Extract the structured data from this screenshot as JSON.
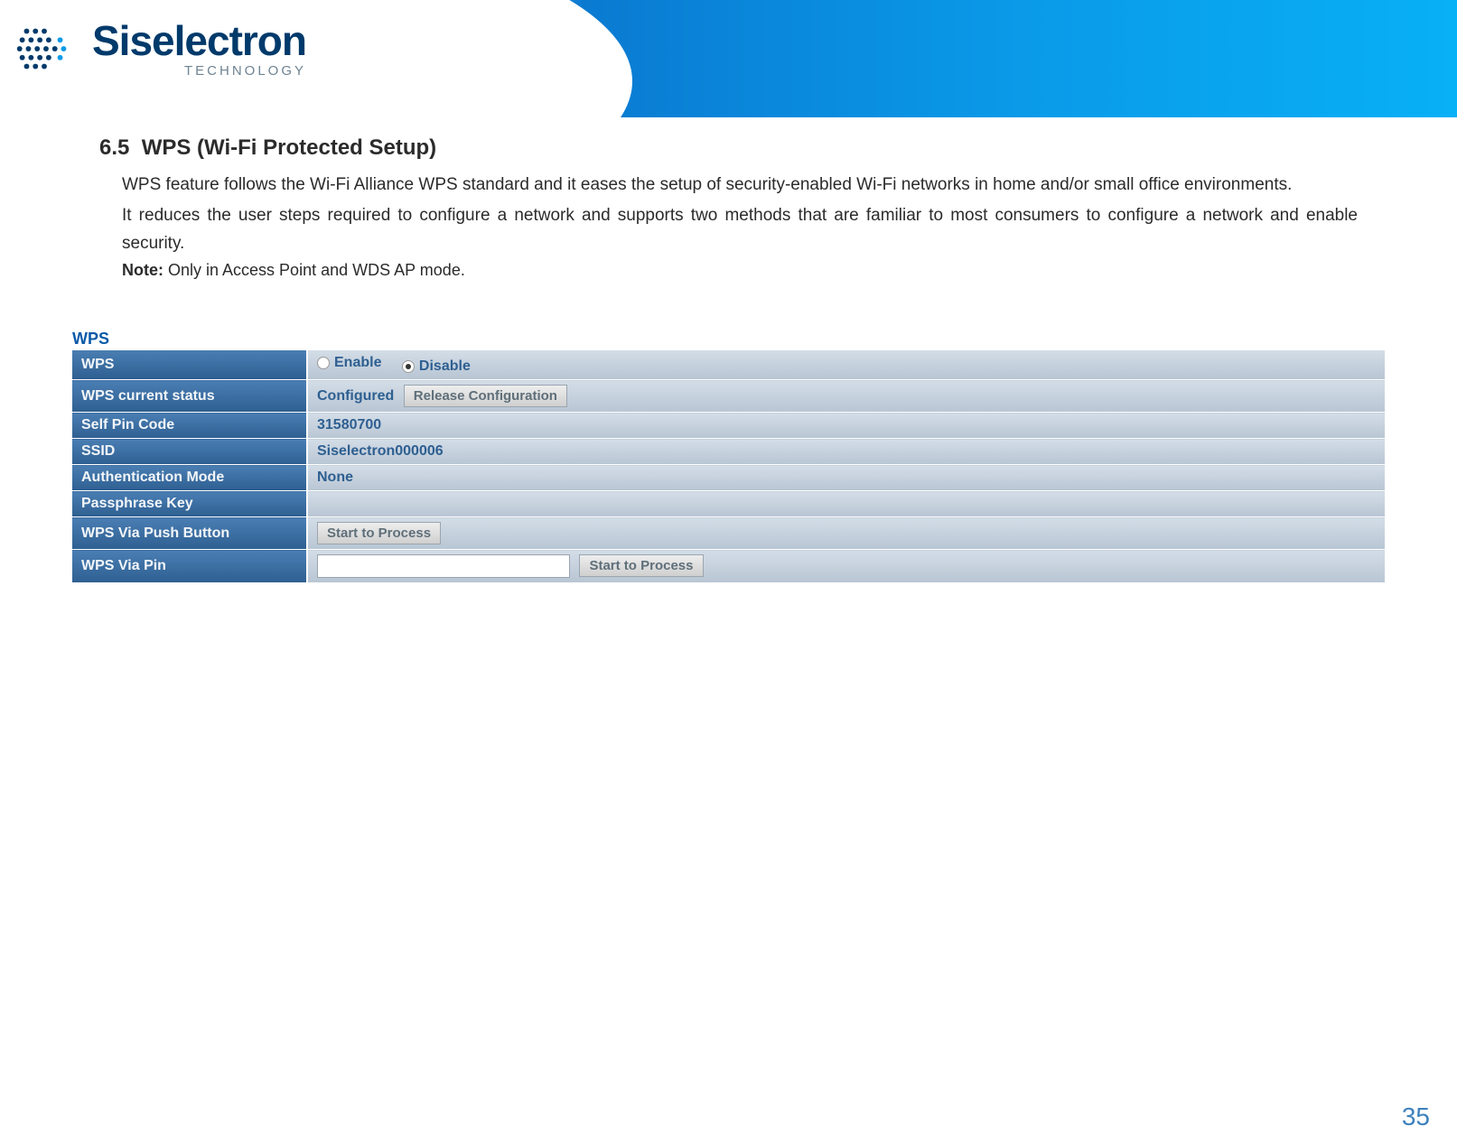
{
  "logo": {
    "brand": "Siselectron",
    "tagline": "TECHNOLOGY"
  },
  "section": {
    "number": "6.5",
    "title": "WPS (Wi-Fi Protected Setup)",
    "para1": "WPS feature follows the Wi-Fi Alliance WPS standard and it eases the setup of security-enabled Wi-Fi networks in home and/or small office environments.",
    "para2": "It reduces the user steps required to configure a network and supports two methods that are familiar to most consumers to configure a network and enable security.",
    "note_label": "Note:",
    "note_text": " Only in Access Point and WDS AP mode."
  },
  "wps": {
    "panel_title": "WPS",
    "rows": {
      "wps_label": "WPS",
      "enable": "Enable",
      "disable": "Disable",
      "status_label": "WPS current status",
      "status_value": "Configured",
      "release_btn": "Release Configuration",
      "selfpin_label": "Self Pin Code",
      "selfpin_value": "31580700",
      "ssid_label": "SSID",
      "ssid_value": "Siselectron000006",
      "auth_label": "Authentication Mode",
      "auth_value": "None",
      "pass_label": "Passphrase Key",
      "push_label": "WPS Via Push Button",
      "push_btn": "Start to Process",
      "pin_label": "WPS Via Pin",
      "pin_btn": "Start to Process"
    }
  },
  "page_number": "35"
}
